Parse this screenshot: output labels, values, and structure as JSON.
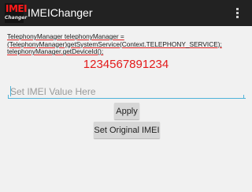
{
  "action_bar": {
    "logo": {
      "top": "IMEI",
      "bottom": "Changer"
    },
    "title": "IMEIChanger",
    "menu_icon": "overflow-menu-icon"
  },
  "code_text": {
    "line1": "TelephonyManager telephonyManager =",
    "line2": "(TelephonyManager)getSystemService(Context.TELEPHONY_SERVICE);",
    "line3": "telephonyManager.getDeviceId();"
  },
  "imei_value": "1234567891234",
  "imei_input": {
    "placeholder": "Set IMEI Value Here",
    "value": ""
  },
  "buttons": {
    "apply": "Apply",
    "set_original": "Set Original IMEI"
  },
  "colors": {
    "action_bar": "#222222",
    "imei_text": "#e31b1b",
    "input_underline": "#4fb3d9",
    "button_bg": "#d6d6d6",
    "background": "#f1f1f1"
  }
}
